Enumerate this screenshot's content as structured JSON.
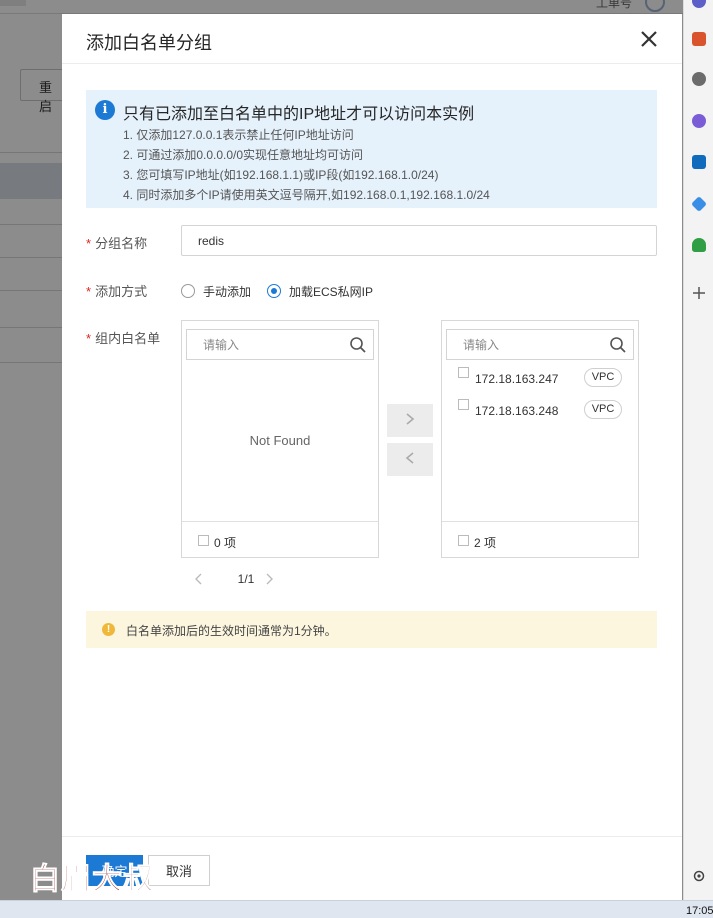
{
  "background": {
    "user_text": "工单号",
    "restart_button": "重启"
  },
  "drawer": {
    "title": "添加白名单分组",
    "info": {
      "title": "只有已添加至白名单中的IP地址才可以访问本实例",
      "lines": [
        "1. 仅添加127.0.0.1表示禁止任何IP地址访问",
        "2. 可通过添加0.0.0.0/0实现任意地址均可访问",
        "3. 您可填写IP地址(如192.168.1.1)或IP段(如192.168.1.0/24)",
        "4. 同时添加多个IP请使用英文逗号隔开,如192.168.0.1,192.168.1.0/24"
      ]
    },
    "form": {
      "group_name_label": "分组名称",
      "group_name_value": "redis",
      "add_method_label": "添加方式",
      "add_method_options": [
        "手动添加",
        "加载ECS私网IP"
      ],
      "add_method_selected": "加载ECS私网IP",
      "whitelist_label": "组内白名单",
      "required_mark": "*"
    },
    "transfer": {
      "left": {
        "search_placeholder": "请输入",
        "empty_text": "Not Found",
        "count_label": "0 项",
        "pager": "1/1"
      },
      "right": {
        "search_placeholder": "请输入",
        "items": [
          {
            "ip": "172.18.163.247",
            "tag": "VPC"
          },
          {
            "ip": "172.18.163.248",
            "tag": "VPC"
          }
        ],
        "count_label": "2 项"
      }
    },
    "notice": "白名单添加后的生效时间通常为1分钟。",
    "footer": {
      "confirm_label": "确定",
      "cancel_label": "取消"
    }
  },
  "taskbar": {
    "clock": "17:05"
  },
  "watermark": "白眉大叔",
  "colors": {
    "primary": "#1c7ad4",
    "info_bg": "#e5f1fb",
    "notice_bg": "#fcf6df",
    "required": "#e2231a",
    "watermark": "#8e1411"
  }
}
